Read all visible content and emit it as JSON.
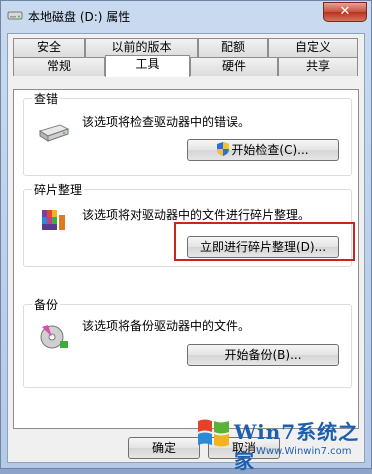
{
  "window": {
    "title": "本地磁盘 (D:) 属性",
    "close_label": "✕"
  },
  "tabs_row1": [
    "安全",
    "以前的版本",
    "配额",
    "自定义"
  ],
  "tabs_row2": [
    "常规",
    "工具",
    "硬件",
    "共享"
  ],
  "active_tab": "工具",
  "groups": {
    "check": {
      "title": "查错",
      "desc": "该选项将检查驱动器中的错误。",
      "button": "开始检查(C)..."
    },
    "defrag": {
      "title": "碎片整理",
      "desc": "该选项将对驱动器中的文件进行碎片整理。",
      "button": "立即进行碎片整理(D)..."
    },
    "backup": {
      "title": "备份",
      "desc": "该选项将备份驱动器中的文件。",
      "button": "开始备份(B)..."
    }
  },
  "footer": {
    "ok": "确定",
    "cancel": "取消"
  },
  "watermark": {
    "main": "Win7系统之家",
    "sub": "Www.Winwin7.com"
  }
}
